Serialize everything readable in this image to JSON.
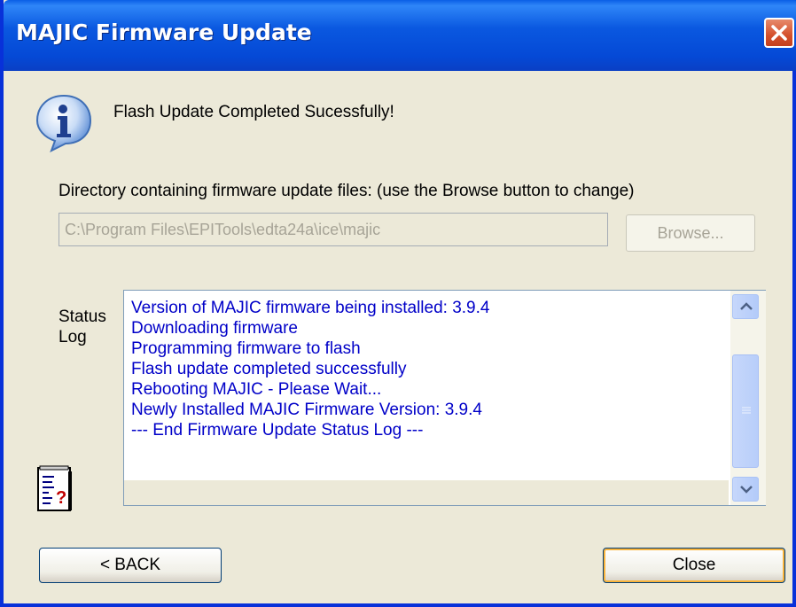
{
  "window": {
    "title": "MAJIC Firmware Update",
    "close_icon": "close-x-icon"
  },
  "message": {
    "icon": "info-icon",
    "text": "Flash Update Completed Sucessfully!"
  },
  "directory": {
    "label": "Directory containing firmware update files: (use the Browse button to change)",
    "value": "C:\\Program Files\\EPITools\\edta24a\\ice\\majic",
    "browse_label": "Browse...",
    "browse_disabled": true
  },
  "status_log": {
    "label_line1": "Status",
    "label_line2": "Log",
    "lines": [
      "Version of MAJIC firmware being installed: 3.9.4",
      "Downloading firmware",
      "Programming firmware to flash",
      "Flash update completed successfully",
      "Rebooting MAJIC - Please Wait...",
      "Newly Installed MAJIC Firmware Version: 3.9.4",
      "--- End Firmware Update Status Log ---"
    ],
    "text_color": "#0000c8"
  },
  "help_icon": "notepad-help-icon",
  "buttons": {
    "back_label": "< BACK",
    "close_label": "Close"
  }
}
